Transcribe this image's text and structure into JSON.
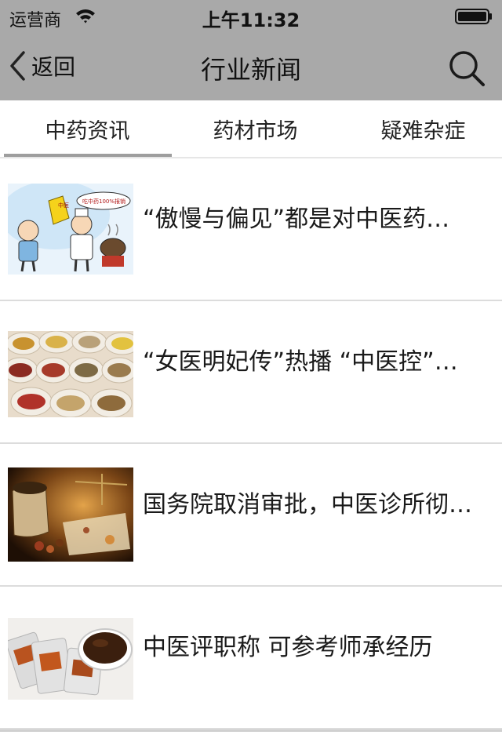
{
  "status_bar": {
    "carrier": "运营商",
    "time": "上午11:32",
    "icons": [
      "wifi-icon",
      "battery-icon"
    ]
  },
  "nav": {
    "back_label": "返回",
    "title": "行业新闻",
    "icons": [
      "chevron-left-icon",
      "search-icon"
    ]
  },
  "tabs": [
    {
      "label": "中药资讯",
      "active": true
    },
    {
      "label": "药材市场",
      "active": false
    },
    {
      "label": "疑难杂症",
      "active": false
    }
  ],
  "news": [
    {
      "title": "“傲慢与偏见”都是对中医药…",
      "thumb_caption": "吃中药100%报销",
      "thumb_badge": "中医"
    },
    {
      "title": "“女医明妃传”热播 “中医控”…"
    },
    {
      "title": "国务院取消审批，中医诊所彻…"
    },
    {
      "title": "中医评职称 可参考师承经历"
    }
  ],
  "colors": {
    "nav_background": "#a9a9a9",
    "tab_indicator": "#9e9e9e",
    "divider": "#dcdcdc"
  }
}
